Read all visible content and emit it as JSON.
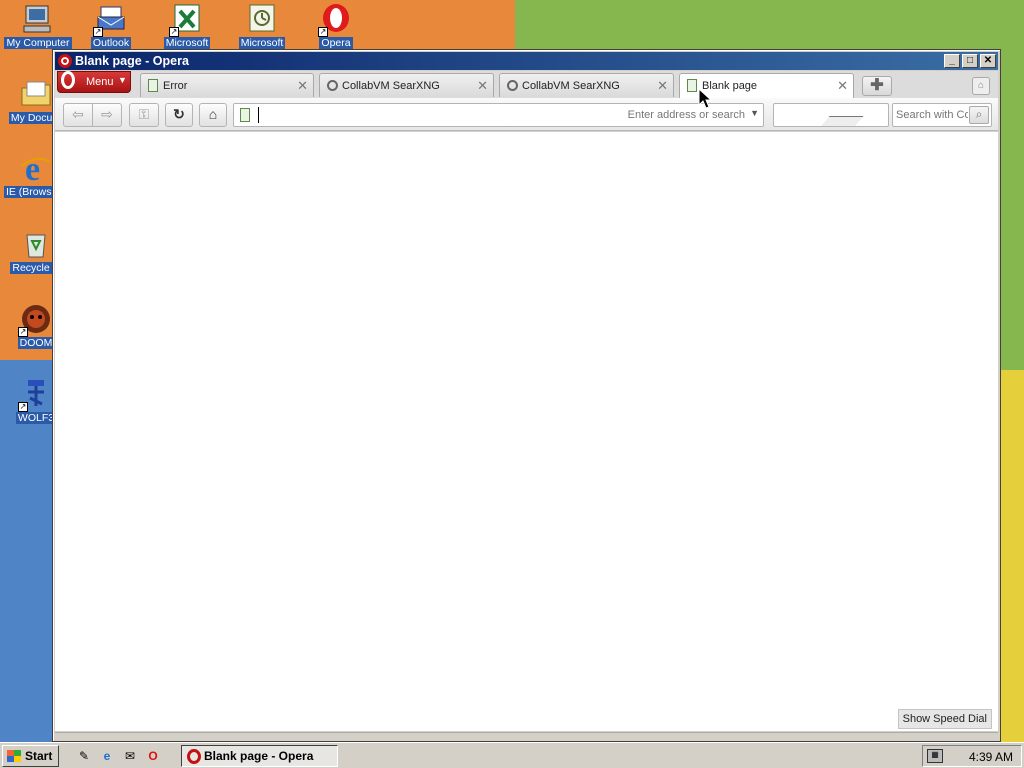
{
  "desktop": {
    "icons": [
      {
        "label": "My Computer"
      },
      {
        "label": "Outlook"
      },
      {
        "label": "Microsoft"
      },
      {
        "label": "Microsoft"
      },
      {
        "label": "Opera"
      },
      {
        "label": "My Docum"
      },
      {
        "label": "IE (Browserv"
      },
      {
        "label": "Recycle B"
      },
      {
        "label": "DOOM"
      },
      {
        "label": "WOLF3"
      }
    ]
  },
  "window": {
    "title": "Blank page - Opera",
    "menu_label": "Menu",
    "tabs": [
      {
        "label": "Error"
      },
      {
        "label": "CollabVM SearXNG"
      },
      {
        "label": "CollabVM SearXNG"
      },
      {
        "label": "Blank page"
      }
    ],
    "address": {
      "value": "",
      "placeholder": "Enter address or search"
    },
    "search": {
      "placeholder": "Search with Co"
    },
    "speed_dial_label": "Show Speed Dial"
  },
  "taskbar": {
    "start_label": "Start",
    "task_label": "Blank page - Opera",
    "clock": "4:39 AM"
  }
}
